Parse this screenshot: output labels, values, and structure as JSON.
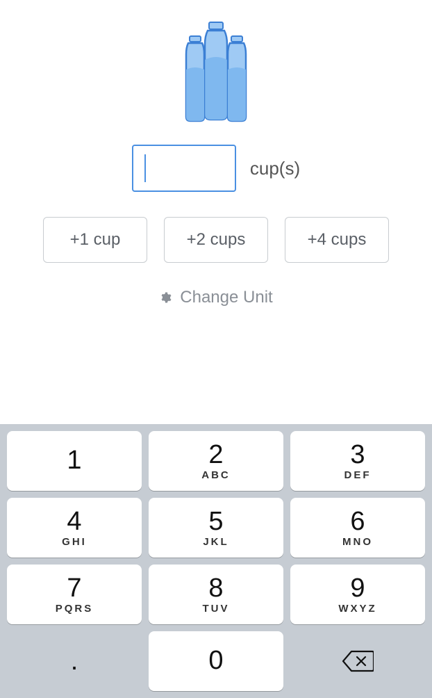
{
  "icon": "water-bottles",
  "input": {
    "value": "",
    "placeholder": ""
  },
  "unit_label": "cup(s)",
  "quick_add": [
    {
      "label": "+1 cup"
    },
    {
      "label": "+2 cups"
    },
    {
      "label": "+4 cups"
    }
  ],
  "change_unit_label": "Change Unit",
  "colors": {
    "accent": "#4a90e2",
    "water": "#9fcaf4",
    "outline": "#3b7fd4",
    "key_tray": "#c6ccd3"
  },
  "keypad": {
    "rows": [
      [
        {
          "num": "1",
          "sub": ""
        },
        {
          "num": "2",
          "sub": "ABC"
        },
        {
          "num": "3",
          "sub": "DEF"
        }
      ],
      [
        {
          "num": "4",
          "sub": "GHI"
        },
        {
          "num": "5",
          "sub": "JKL"
        },
        {
          "num": "6",
          "sub": "MNO"
        }
      ],
      [
        {
          "num": "7",
          "sub": "PQRS"
        },
        {
          "num": "8",
          "sub": "TUV"
        },
        {
          "num": "9",
          "sub": "WXYZ"
        }
      ],
      [
        {
          "num": ".",
          "sub": "",
          "aux": true
        },
        {
          "num": "0",
          "sub": ""
        },
        {
          "icon": "backspace",
          "aux": true
        }
      ]
    ]
  }
}
